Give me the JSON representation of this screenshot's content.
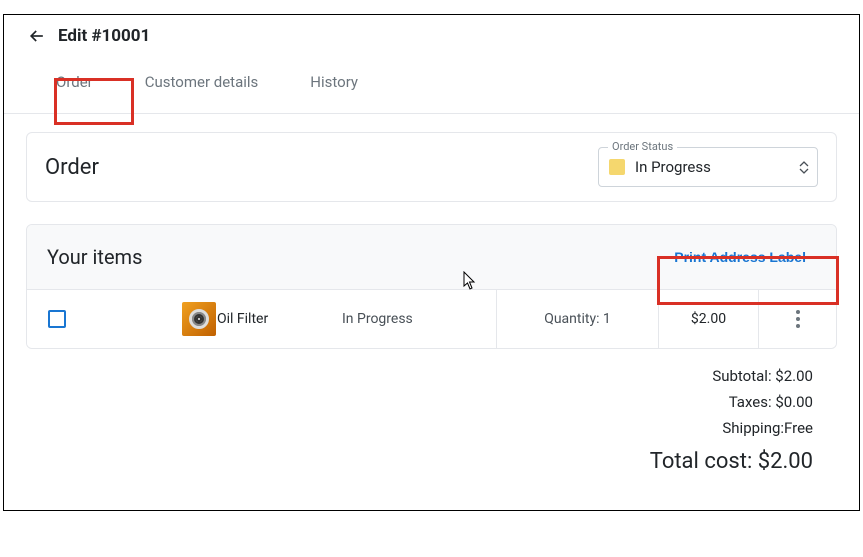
{
  "header": {
    "title": "Edit #10001"
  },
  "tabs": {
    "order": "Order",
    "customer": "Customer details",
    "history": "History"
  },
  "order_section": {
    "heading": "Order",
    "status_legend": "Order Status",
    "status_value": "In Progress"
  },
  "items_section": {
    "heading": "Your items",
    "print_label": "Print Address Label",
    "rows": [
      {
        "name": "Oil Filter",
        "status": "In Progress",
        "qty_label": "Quantity: 1",
        "price": "$2.00"
      }
    ]
  },
  "totals": {
    "subtotal": "Subtotal: $2.00",
    "taxes": "Taxes: $0.00",
    "shipping": "Shipping:Free",
    "total": "Total cost: $2.00"
  },
  "highlight_color": "#d93025"
}
